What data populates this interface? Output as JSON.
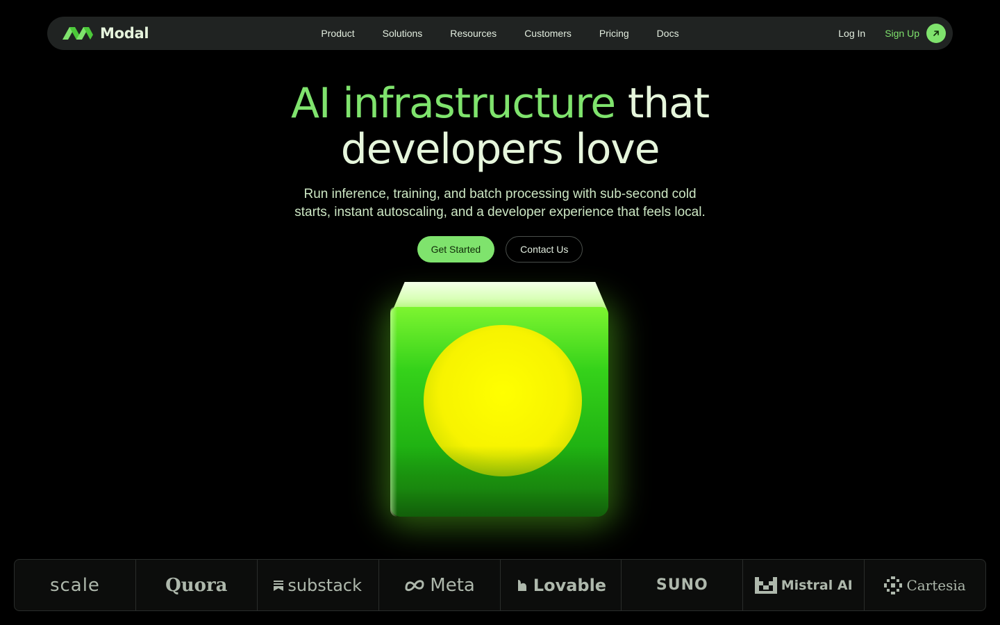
{
  "colors": {
    "background": "#000000",
    "accent": "#7fe36d",
    "nav_background": "#202322",
    "text": "#e6f6dc"
  },
  "nav": {
    "brand": "Modal",
    "links": [
      "Product",
      "Solutions",
      "Resources",
      "Customers",
      "Pricing",
      "Docs"
    ],
    "login": "Log In",
    "signup": "Sign Up",
    "signup_icon": "arrow-up-right-icon"
  },
  "hero": {
    "title_accent": "AI infrastructure",
    "title_rest": " that",
    "title_line2": "developers love",
    "subtitle_line1": "Run inference, training, and batch processing with sub-second cold",
    "subtitle_line2": "starts, instant autoscaling, and a developer experience that feels local.",
    "primary_cta": "Get Started",
    "secondary_cta": "Contact Us"
  },
  "customers": [
    "scale",
    "Quora",
    "substack",
    "Meta",
    "Lovable",
    "SUNO",
    "Mistral AI",
    "Cartesia"
  ]
}
